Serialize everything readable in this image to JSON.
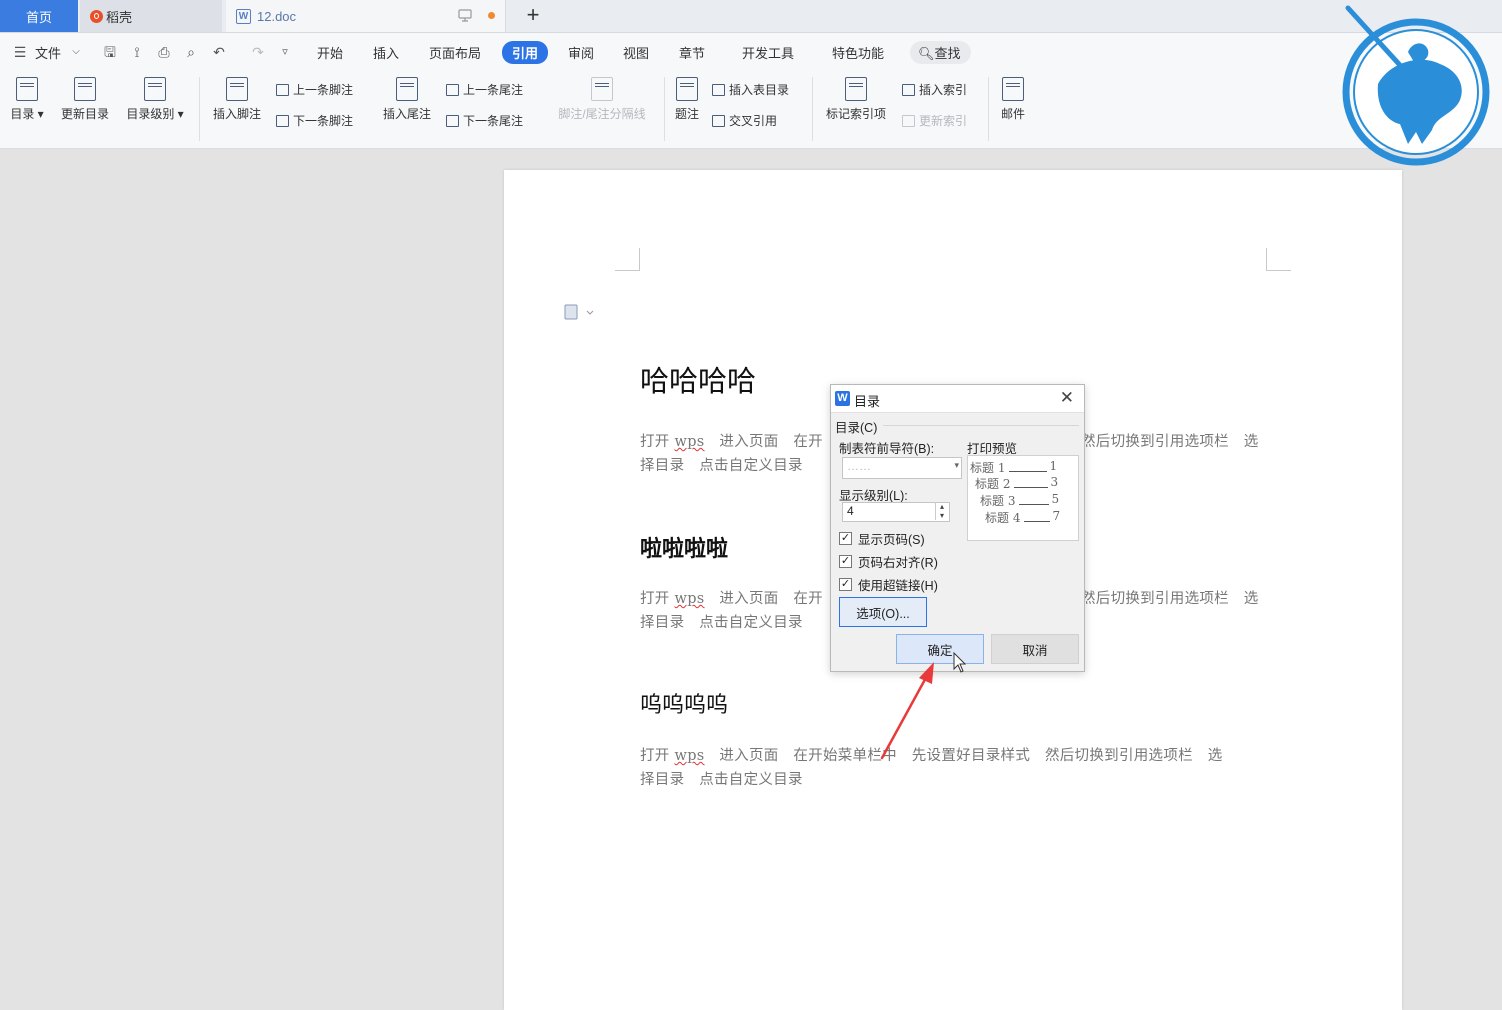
{
  "tabs": {
    "home": "首页",
    "daoke": "稻壳",
    "doc": "12.doc"
  },
  "menu": {
    "file": "文件",
    "items": [
      "开始",
      "插入",
      "页面布局",
      "引用",
      "审阅",
      "视图",
      "章节",
      "开发工具",
      "特色功能"
    ],
    "search": "查找"
  },
  "ribbon": {
    "toc": "目录",
    "update_toc": "更新目录",
    "toc_level": "目录级别",
    "insert_footnote": "插入脚注",
    "prev_footnote": "上一条脚注",
    "next_footnote": "下一条脚注",
    "insert_endnote": "插入尾注",
    "prev_endnote": "上一条尾注",
    "next_endnote": "下一条尾注",
    "footnote_separator": "脚注/尾注分隔线",
    "caption": "题注",
    "insert_table_of_figures": "插入表目录",
    "cross_reference": "交叉引用",
    "mark_index_entry": "标记索引项",
    "insert_index": "插入索引",
    "update_index": "更新索引",
    "mail": "邮件"
  },
  "document": {
    "heading1": "哈哈哈哈",
    "heading2": "啦啦啦啦",
    "heading3": "呜呜呜呜",
    "p_wps": "wps",
    "p1_line1_left": "打开 ",
    "p1_line1_mid": "　进入页面　在开",
    "p1_line1_right": "然后切换到引用选项栏　选",
    "p1_line2": "择目录　点击自定义目录",
    "p3_line1_rest": "　进入页面　在开始菜单栏中　先设置好目录样式　然后切换到引用选项栏　选",
    "p3_line2": "择目录　点击自定义目录"
  },
  "dialog": {
    "title": "目录",
    "group": "目录(C)",
    "tab_leader_label": "制表符前导符(B):",
    "tab_leader_value": "……",
    "print_preview_label": "打印预览",
    "show_level_label": "显示级别(L):",
    "show_level_value": "4",
    "show_page_numbers": "显示页码(S)",
    "right_align_page_numbers": "页码右对齐(R)",
    "use_hyperlinks": "使用超链接(H)",
    "options_button": "选项(O)...",
    "ok_button": "确定",
    "cancel_button": "取消",
    "preview": [
      {
        "label": "标题 1",
        "page": "1"
      },
      {
        "label": "标题 2",
        "page": "3"
      },
      {
        "label": "标题 3",
        "page": "5"
      },
      {
        "label": "标题 4",
        "page": "7"
      }
    ]
  },
  "colors": {
    "accent": "#2c73e6",
    "home_tab": "#3a7ce0",
    "arrow": "#e83a3a",
    "logo": "#2a8ed8"
  }
}
